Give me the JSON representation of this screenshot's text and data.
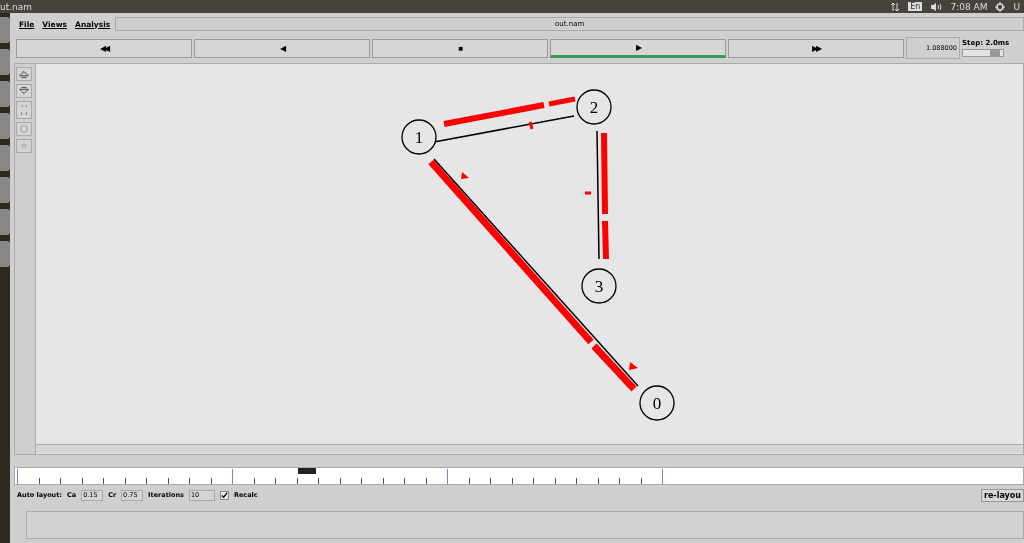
{
  "desktop_bar": {
    "window_title": "ut.nam",
    "keyboard": "En",
    "clock": "7:08 AM",
    "user": "U"
  },
  "menu": [
    {
      "label": "File"
    },
    {
      "label": "Views"
    },
    {
      "label": "Analysis"
    }
  ],
  "file_title": "out.nam",
  "transport": [
    {
      "glyph": "◀◀",
      "selected": false
    },
    {
      "glyph": "◀",
      "selected": false
    },
    {
      "glyph": "■",
      "selected": false
    },
    {
      "glyph": "▶",
      "selected": true
    },
    {
      "glyph": "▶▶",
      "selected": false
    }
  ],
  "time": "1.088000",
  "step": {
    "label": "Step: 2.0ms",
    "level": 0.8
  },
  "nodes": [
    {
      "label": "1"
    },
    {
      "label": "2"
    },
    {
      "label": "3"
    },
    {
      "label": "0"
    }
  ],
  "timeline": {
    "level": 0.29
  },
  "auto_layout": {
    "label": "Auto layout:",
    "fields": [
      {
        "label": "Ca",
        "value": "0.15"
      },
      {
        "label": "Cr",
        "value": "0.75"
      },
      {
        "label": "Iterations",
        "value": "10"
      }
    ],
    "recalc": {
      "label": "Recalc",
      "checked": true
    },
    "button": "re-layou"
  }
}
